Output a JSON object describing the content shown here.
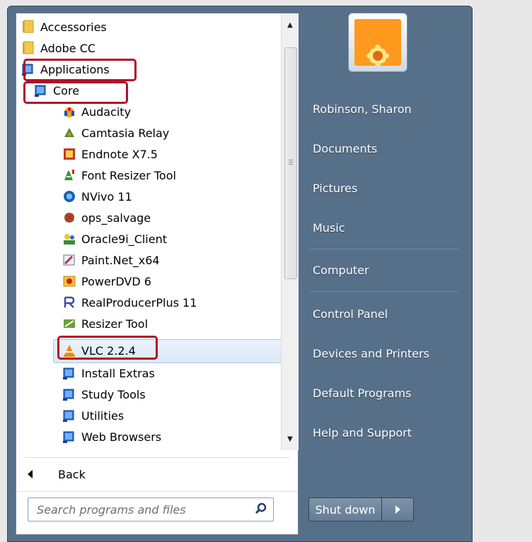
{
  "programs": {
    "items": [
      {
        "label": "Accessories",
        "icon": "folder-icon"
      },
      {
        "label": "Adobe CC",
        "icon": "folder-icon"
      },
      {
        "label": "Applications",
        "icon": "program-group-icon"
      },
      {
        "label": "Core",
        "icon": "program-group-icon"
      },
      {
        "label": "Audacity",
        "icon": "audacity-icon"
      },
      {
        "label": "Camtasia Relay",
        "icon": "camtasia-relay-icon"
      },
      {
        "label": "Endnote X7.5",
        "icon": "endnote-icon"
      },
      {
        "label": "Font Resizer Tool",
        "icon": "font-resizer-icon"
      },
      {
        "label": "NVivo 11",
        "icon": "nvivo-icon"
      },
      {
        "label": "ops_salvage",
        "icon": "ops-salvage-icon"
      },
      {
        "label": "Oracle9i_Client",
        "icon": "oracle-client-icon"
      },
      {
        "label": "Paint.Net_x64",
        "icon": "paint-net-icon"
      },
      {
        "label": "PowerDVD 6",
        "icon": "powerdvd-icon"
      },
      {
        "label": "RealProducerPlus 11",
        "icon": "realproducer-icon"
      },
      {
        "label": "Resizer Tool",
        "icon": "resizer-tool-icon"
      },
      {
        "label": "VLC 2.2.4",
        "icon": "vlc-icon"
      },
      {
        "label": "Install Extras",
        "icon": "program-group-icon"
      },
      {
        "label": "Study Tools",
        "icon": "program-group-icon"
      },
      {
        "label": "Utilities",
        "icon": "program-group-icon"
      },
      {
        "label": "Web Browsers",
        "icon": "program-group-icon"
      }
    ],
    "selected": "VLC 2.2.4",
    "back_label": "Back"
  },
  "search": {
    "placeholder": "Search programs and files"
  },
  "right_pane": {
    "user_name": "Robinson, Sharon",
    "links": [
      "Documents",
      "Pictures",
      "Music",
      "Computer",
      "Control Panel",
      "Devices and Printers",
      "Default Programs",
      "Help and Support"
    ]
  },
  "shutdown": {
    "label": "Shut down"
  },
  "colors": {
    "highlight_border": "#b0102a",
    "pane_background": "#57708a"
  }
}
